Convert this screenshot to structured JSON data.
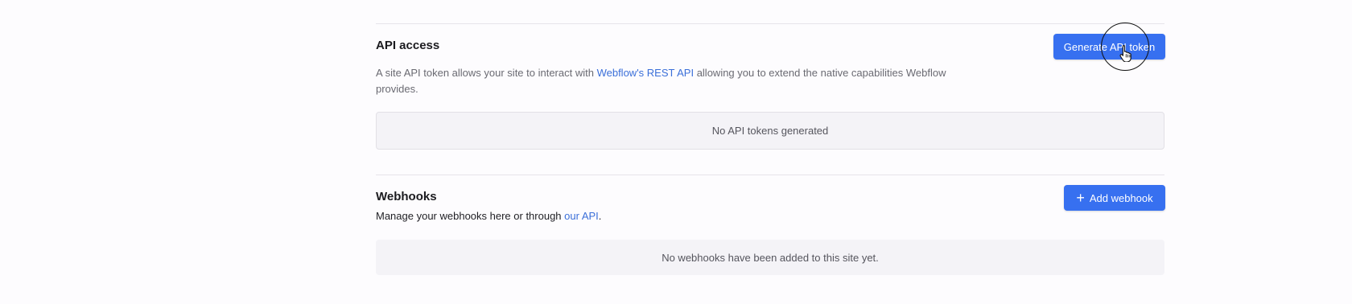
{
  "api_access": {
    "title": "API access",
    "description_prefix": "A site API token allows your site to interact with ",
    "description_link": "Webflow's REST API",
    "description_suffix": " allowing you to extend the native capabilities Webflow provides.",
    "generate_button_label": "Generate API token",
    "empty_message": "No API tokens generated"
  },
  "webhooks": {
    "title": "Webhooks",
    "description_prefix": "Manage your webhooks here or through ",
    "description_link": "our API",
    "description_suffix": ".",
    "add_button_label": "Add webhook",
    "add_button_icon": "plus-icon",
    "empty_message": "No webhooks have been added to this site yet."
  },
  "cursor": {
    "icon": "hand-pointer-icon"
  },
  "colors": {
    "accent": "#3770f0",
    "link": "#3b6fd9",
    "empty_bg": "#f4f3f7"
  }
}
